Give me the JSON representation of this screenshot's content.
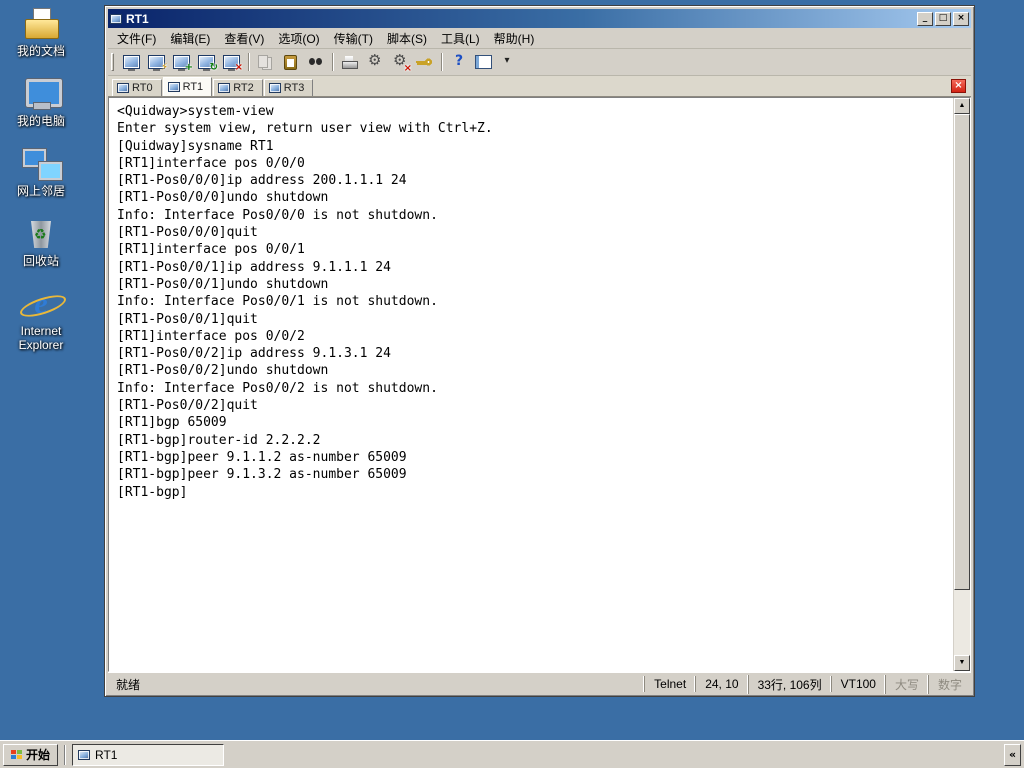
{
  "desktop": {
    "icons": [
      {
        "id": "my-documents",
        "label": "我的文档"
      },
      {
        "id": "my-computer",
        "label": "我的电脑"
      },
      {
        "id": "network-places",
        "label": "网上邻居"
      },
      {
        "id": "recycle-bin",
        "label": "回收站"
      },
      {
        "id": "internet-explorer",
        "label": "Internet Explorer"
      }
    ]
  },
  "window": {
    "title": "RT1",
    "controls": {
      "minimize": "_",
      "maximize": "□",
      "close": "×"
    },
    "tab_close": "×",
    "scrollbar": {
      "up": "▲",
      "down": "▼"
    },
    "menu": [
      {
        "id": "file",
        "label": "文件(F)"
      },
      {
        "id": "edit",
        "label": "编辑(E)"
      },
      {
        "id": "view",
        "label": "查看(V)"
      },
      {
        "id": "options",
        "label": "选项(O)"
      },
      {
        "id": "transfer",
        "label": "传输(T)"
      },
      {
        "id": "script",
        "label": "脚本(S)"
      },
      {
        "id": "tools",
        "label": "工具(L)"
      },
      {
        "id": "help",
        "label": "帮助(H)"
      }
    ],
    "toolbar": [
      {
        "name": "connect",
        "base": "term"
      },
      {
        "name": "quick-connect",
        "base": "term",
        "ov": "⚡",
        "ovColor": "#d99a00"
      },
      {
        "name": "connect-in-tab",
        "base": "term",
        "ov": "+",
        "ovColor": "#0a7a0a"
      },
      {
        "name": "reconnect",
        "base": "term",
        "ov": "↻",
        "ovColor": "#0a7a0a"
      },
      {
        "name": "disconnect",
        "base": "term",
        "ov": "×",
        "ovColor": "#cc1100"
      },
      {
        "sep": true
      },
      {
        "name": "copy",
        "base": "copy",
        "disabled": true
      },
      {
        "name": "paste",
        "base": "paste"
      },
      {
        "name": "find",
        "base": "find"
      },
      {
        "sep": true
      },
      {
        "name": "print",
        "base": "print"
      },
      {
        "name": "session-options",
        "base": "gear"
      },
      {
        "name": "global-options",
        "base": "gear",
        "ov": "×",
        "ovColor": "#cc1100"
      },
      {
        "name": "keymap",
        "base": "key"
      },
      {
        "sep": true
      },
      {
        "name": "help",
        "base": "help"
      },
      {
        "name": "session-manager",
        "base": "panel"
      },
      {
        "name": "toolbar-overflow",
        "base": "chevron"
      }
    ],
    "tabs": [
      {
        "label": "RT0",
        "active": false
      },
      {
        "label": "RT1",
        "active": true
      },
      {
        "label": "RT2",
        "active": false
      },
      {
        "label": "RT3",
        "active": false
      }
    ],
    "terminal_lines": [
      "<Quidway>system-view",
      "Enter system view, return user view with Ctrl+Z.",
      "[Quidway]sysname RT1",
      "[RT1]interface pos 0/0/0",
      "[RT1-Pos0/0/0]ip address 200.1.1.1 24",
      "[RT1-Pos0/0/0]undo shutdown",
      "Info: Interface Pos0/0/0 is not shutdown.",
      "[RT1-Pos0/0/0]quit",
      "[RT1]interface pos 0/0/1",
      "[RT1-Pos0/0/1]ip address 9.1.1.1 24",
      "[RT1-Pos0/0/1]undo shutdown",
      "Info: Interface Pos0/0/1 is not shutdown.",
      "[RT1-Pos0/0/1]quit",
      "[RT1]interface pos 0/0/2",
      "[RT1-Pos0/0/2]ip address 9.1.3.1 24",
      "[RT1-Pos0/0/2]undo shutdown",
      "Info: Interface Pos0/0/2 is not shutdown.",
      "[RT1-Pos0/0/2]quit",
      "[RT1]bgp 65009",
      "[RT1-bgp]router-id 2.2.2.2",
      "[RT1-bgp]peer 9.1.1.2 as-number 65009",
      "[RT1-bgp]peer 9.1.3.2 as-number 65009",
      "[RT1-bgp]"
    ],
    "status": {
      "ready": "就绪",
      "protocol": "Telnet",
      "cursor_position": "24, 10",
      "screen_size": "33行, 106列",
      "emulation": "VT100",
      "caps_indicator": "大写",
      "num_indicator": "数字"
    }
  },
  "taskbar": {
    "start_label": "开始",
    "items": [
      {
        "label": "RT1",
        "active": true
      }
    ],
    "tray_collapse": "«"
  }
}
